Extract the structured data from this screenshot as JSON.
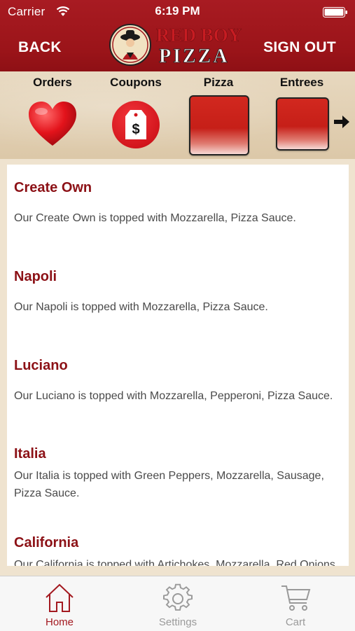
{
  "status_bar": {
    "carrier": "Carrier",
    "time": "6:19 PM",
    "wifi_icon": "wifi-icon",
    "battery_icon": "battery-icon"
  },
  "header": {
    "back_label": "BACK",
    "sign_out_label": "SIGN OUT",
    "logo_line1": "RED BOY",
    "logo_line2": "PIZZA",
    "brand_color": "#9b1419"
  },
  "categories": [
    {
      "label": "Orders",
      "icon": "heart-icon"
    },
    {
      "label": "Coupons",
      "icon": "price-tag-icon"
    },
    {
      "label": "Pizza",
      "icon": "red-tile-image"
    },
    {
      "label": "Entrees",
      "icon": "red-tile-image"
    }
  ],
  "more_arrow_icon": "arrow-right-icon",
  "menu_items": [
    {
      "title": "Create Own",
      "description": "Our Create Own is topped with Mozzarella, Pizza Sauce."
    },
    {
      "title": "Napoli",
      "description": "Our Napoli is topped with Mozzarella, Pizza Sauce."
    },
    {
      "title": "Luciano",
      "description": "Our Luciano is topped with Mozzarella, Pepperoni, Pizza Sauce."
    },
    {
      "title": "Italia",
      "description": "Our Italia is topped with Green Peppers, Mozzarella, Sausage, Pizza Sauce."
    },
    {
      "title": "California",
      "description": "Our California is topped with Artichokes, Mozzarella, Red Onions"
    }
  ],
  "tabs": [
    {
      "label": "Home",
      "icon": "home-icon",
      "active": true
    },
    {
      "label": "Settings",
      "icon": "gear-icon",
      "active": false
    },
    {
      "label": "Cart",
      "icon": "cart-icon",
      "active": false
    }
  ],
  "colors": {
    "accent": "#a31920",
    "title_red": "#8c1116",
    "inactive_tab": "#9a9a9a"
  }
}
